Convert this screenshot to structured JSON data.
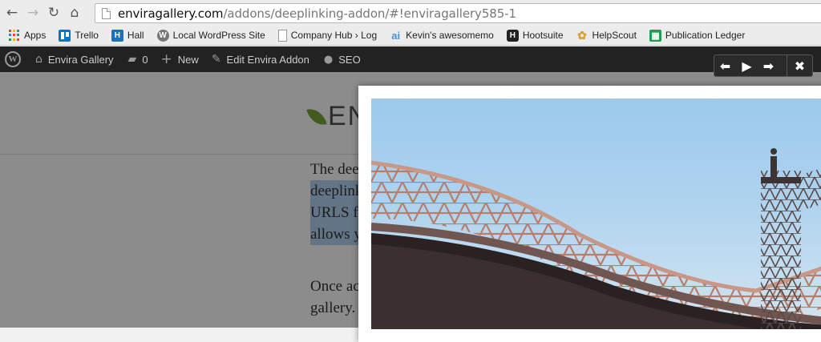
{
  "browser": {
    "url_domain": "enviragallery.com",
    "url_path": "/addons/deeplinking-addon/#!enviragallery585-1"
  },
  "bookmarks": [
    {
      "label": "Apps",
      "icon": "apps-grid-icon"
    },
    {
      "label": "Trello",
      "icon": "trello-icon",
      "color": "#0079bf",
      "glyph": ""
    },
    {
      "label": "Hall",
      "icon": "hall-icon",
      "color": "#1f6fbf",
      "glyph": "H"
    },
    {
      "label": "Local WordPress Site",
      "icon": "wordpress-icon",
      "color": "#777",
      "glyph": "W"
    },
    {
      "label": "Company Hub › Log",
      "icon": "page-icon",
      "color": "#fff",
      "glyph": ""
    },
    {
      "label": "Kevin's awesomemo",
      "icon": "ai-icon",
      "color": "#4a90d9",
      "glyph": "ai"
    },
    {
      "label": "Hootsuite",
      "icon": "hootsuite-icon",
      "color": "#222",
      "glyph": "H"
    },
    {
      "label": "HelpScout",
      "icon": "helpscout-icon",
      "color": "#d9a334",
      "glyph": "✿"
    },
    {
      "label": "Publication Ledger",
      "icon": "sheets-icon",
      "color": "#1e9f4f",
      "glyph": "▦"
    }
  ],
  "admin_bar": {
    "site_name": "Envira Gallery",
    "comments_count": "0",
    "new_label": "New",
    "edit_label": "Edit Envira Addon",
    "seo_label": "SEO"
  },
  "page": {
    "logo_text": "ENVIRA",
    "para1_lines": [
      "The dee",
      "deeplink",
      "URLS f",
      "allows y"
    ],
    "para2_lines": [
      "Once ac",
      "gallery. "
    ]
  },
  "lightbox": {
    "controls": {
      "prev": "⬅",
      "play": "▶",
      "next": "➡",
      "close": "✖"
    }
  },
  "colors": {
    "admin_bar": "#222222",
    "highlight": "#b5d3f5",
    "bridge": "#c88f7d"
  }
}
